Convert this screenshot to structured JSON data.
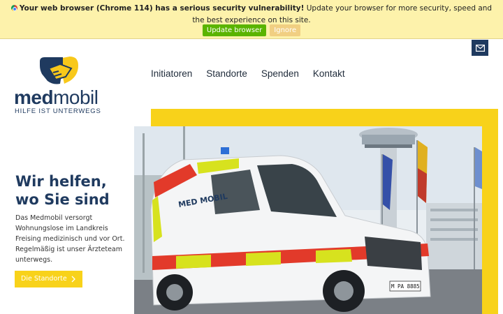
{
  "banner": {
    "warning_bold": "Your web browser (Chrome 114) has a serious security vulnerability!",
    "warning_text": " Update your browser for more security, speed and the best experience on this site.",
    "update_label": "Update browser",
    "ignore_label": "Ignore"
  },
  "logo": {
    "word_bold": "med",
    "word_light": "mobil",
    "tagline": "HILFE IST UNTERWEGS"
  },
  "nav": {
    "items": [
      {
        "label": "Initiatoren"
      },
      {
        "label": "Standorte"
      },
      {
        "label": "Spenden"
      },
      {
        "label": "Kontakt"
      }
    ]
  },
  "hero": {
    "title_line1": "Wir helfen,",
    "title_line2": "wo Sie sind",
    "text": "Das Medmobil versorgt Wohnungslose im Landkreis Freising medizinisch und vor Ort. Regelmäßig ist unser Ärzteteam unterwegs.",
    "cta_label": "Die Standorte",
    "image_label": "MED MOBIL",
    "plate": "M PA 8885"
  },
  "colors": {
    "brand_navy": "#1f3a5f",
    "brand_yellow": "#f8d21a",
    "banner_bg": "#fdf2ab",
    "update_green": "#5ab400"
  },
  "icons": [
    "chrome-icon",
    "mail-icon",
    "handshake-logo-icon",
    "chevron-right-icon"
  ]
}
